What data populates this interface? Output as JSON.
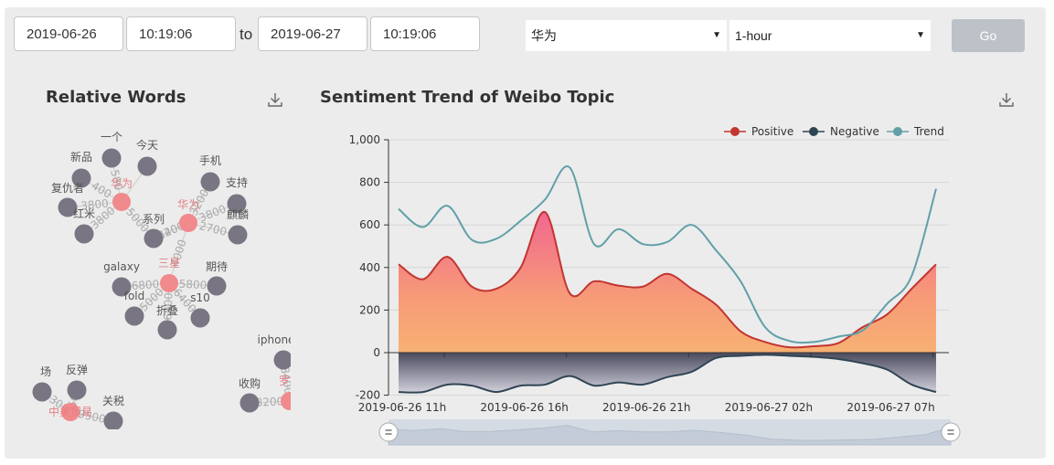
{
  "controls": {
    "start_date": "2019-06-26",
    "start_time": "10:19:06",
    "to_label": "to",
    "end_date": "2019-06-27",
    "end_time": "10:19:06",
    "topic": "华为",
    "interval": "1-hour",
    "go_label": "Go"
  },
  "words_panel": {
    "title": "Relative Words",
    "download_icon": "download-icon",
    "graph": {
      "edge_color": "#cccccc",
      "center_color": "#f08a8c",
      "leaf_color": "#797582",
      "label_color_leaf": "#555555",
      "label_color_center": "#e57f84",
      "weight_color": "#aaaaaa",
      "nodes": [
        {
          "id": "c1",
          "label": "华为",
          "kind": "center"
        },
        {
          "id": "c2",
          "label": "华为",
          "kind": "center"
        },
        {
          "id": "c3",
          "label": "三星",
          "kind": "center"
        },
        {
          "id": "n1",
          "label": "新品",
          "kind": "leaf"
        },
        {
          "id": "n2",
          "label": "一个",
          "kind": "leaf"
        },
        {
          "id": "n3",
          "label": "今天",
          "kind": "leaf"
        },
        {
          "id": "n4",
          "label": "复仇者",
          "kind": "leaf"
        },
        {
          "id": "n5",
          "label": "红米",
          "kind": "leaf"
        },
        {
          "id": "n6",
          "label": "系列",
          "kind": "leaf"
        },
        {
          "id": "n7",
          "label": "手机",
          "kind": "leaf"
        },
        {
          "id": "n8",
          "label": "支持",
          "kind": "leaf"
        },
        {
          "id": "n9",
          "label": "麒麟",
          "kind": "leaf"
        },
        {
          "id": "n10",
          "label": "galaxy",
          "kind": "leaf"
        },
        {
          "id": "n11",
          "label": "fold",
          "kind": "leaf"
        },
        {
          "id": "n12",
          "label": "折叠",
          "kind": "leaf"
        },
        {
          "id": "n13",
          "label": "期待",
          "kind": "leaf"
        },
        {
          "id": "n14",
          "label": "s10",
          "kind": "leaf"
        },
        {
          "id": "n15",
          "label": "反弹",
          "kind": "leaf"
        },
        {
          "id": "n16",
          "label": "场",
          "kind": "leaf"
        },
        {
          "id": "n17",
          "label": "中美贸易",
          "kind": "center"
        },
        {
          "id": "n18",
          "label": "关税",
          "kind": "leaf"
        },
        {
          "id": "n19",
          "label": "iphone",
          "kind": "leaf"
        },
        {
          "id": "n20",
          "label": "收购",
          "kind": "leaf"
        },
        {
          "id": "n21",
          "label": "罗",
          "kind": "center"
        }
      ],
      "edges": [
        {
          "from": "c1",
          "to": "n1",
          "weight": "400"
        },
        {
          "from": "c1",
          "to": "n2",
          "weight": "580"
        },
        {
          "from": "c1",
          "to": "n3",
          "weight": ""
        },
        {
          "from": "c1",
          "to": "n4",
          "weight": "3800"
        },
        {
          "from": "c1",
          "to": "n5",
          "weight": "3800"
        },
        {
          "from": "c1",
          "to": "n6",
          "weight": "5000"
        },
        {
          "from": "c2",
          "to": "n6",
          "weight": "3200"
        },
        {
          "from": "c2",
          "to": "n7",
          "weight": "3200"
        },
        {
          "from": "c2",
          "to": "n8",
          "weight": "3800"
        },
        {
          "from": "c2",
          "to": "n9",
          "weight": "2700"
        },
        {
          "from": "c2",
          "to": "n6",
          "weight": "1400"
        },
        {
          "from": "c2",
          "to": "c3",
          "weight": "4000"
        },
        {
          "from": "c3",
          "to": "n10",
          "weight": "6800"
        },
        {
          "from": "c3",
          "to": "n11",
          "weight": "5000"
        },
        {
          "from": "c3",
          "to": "n12",
          "weight": "6800"
        },
        {
          "from": "c3",
          "to": "n13",
          "weight": "5800"
        },
        {
          "from": "c3",
          "to": "n14",
          "weight": "6400"
        },
        {
          "from": "n17",
          "to": "n15",
          "weight": "9500"
        },
        {
          "from": "n17",
          "to": "n16",
          "weight": "9300"
        },
        {
          "from": "n17",
          "to": "n18",
          "weight": "9500"
        },
        {
          "from": "n21",
          "to": "n20",
          "weight": "8200"
        },
        {
          "from": "n21",
          "to": "n19",
          "weight": "8400"
        }
      ]
    }
  },
  "trend_panel": {
    "title": "Sentiment Trend of Weibo Topic",
    "download_icon": "download-icon"
  },
  "chart_data": {
    "type": "line",
    "title": "Sentiment Trend of Weibo Topic",
    "x": [
      "2019-06-26 11h",
      "2019-06-26 12h",
      "2019-06-26 13h",
      "2019-06-26 14h",
      "2019-06-26 15h",
      "2019-06-26 16h",
      "2019-06-26 17h",
      "2019-06-26 18h",
      "2019-06-26 19h",
      "2019-06-26 20h",
      "2019-06-26 21h",
      "2019-06-26 22h",
      "2019-06-26 23h",
      "2019-06-27 00h",
      "2019-06-27 01h",
      "2019-06-27 02h",
      "2019-06-27 03h",
      "2019-06-27 04h",
      "2019-06-27 05h",
      "2019-06-27 06h",
      "2019-06-27 07h",
      "2019-06-27 08h",
      "2019-06-27 09h"
    ],
    "x_tick_labels": [
      "2019-06-26 11h",
      "2019-06-26 16h",
      "2019-06-26 21h",
      "2019-06-27 02h",
      "2019-06-27 07h"
    ],
    "x_tick_indices": [
      0,
      5,
      10,
      15,
      20
    ],
    "series": [
      {
        "name": "Positive",
        "color": "#c23531",
        "values": [
          415,
          345,
          450,
          310,
          300,
          400,
          660,
          280,
          335,
          315,
          310,
          370,
          300,
          225,
          100,
          50,
          25,
          30,
          45,
          120,
          180,
          300,
          415
        ]
      },
      {
        "name": "Negative",
        "color": "#2f4554",
        "values": [
          -185,
          -185,
          -150,
          -155,
          -185,
          -155,
          -150,
          -110,
          -155,
          -140,
          -150,
          -115,
          -90,
          -25,
          -15,
          -10,
          -15,
          -20,
          -30,
          -50,
          -80,
          -150,
          -185
        ]
      },
      {
        "name": "Trend",
        "color": "#61a0a8",
        "values": [
          675,
          590,
          690,
          530,
          535,
          620,
          720,
          870,
          510,
          580,
          510,
          520,
          600,
          480,
          335,
          120,
          55,
          50,
          75,
          105,
          230,
          360,
          770
        ]
      }
    ],
    "ylim": [
      -200,
      1000
    ],
    "y_ticks": [
      -200,
      0,
      200,
      400,
      600,
      800,
      1000
    ],
    "y_tick_labels": [
      "-200",
      "0",
      "200",
      "400",
      "600",
      "800",
      "1,000"
    ],
    "grid": true,
    "legend": "top-right"
  }
}
